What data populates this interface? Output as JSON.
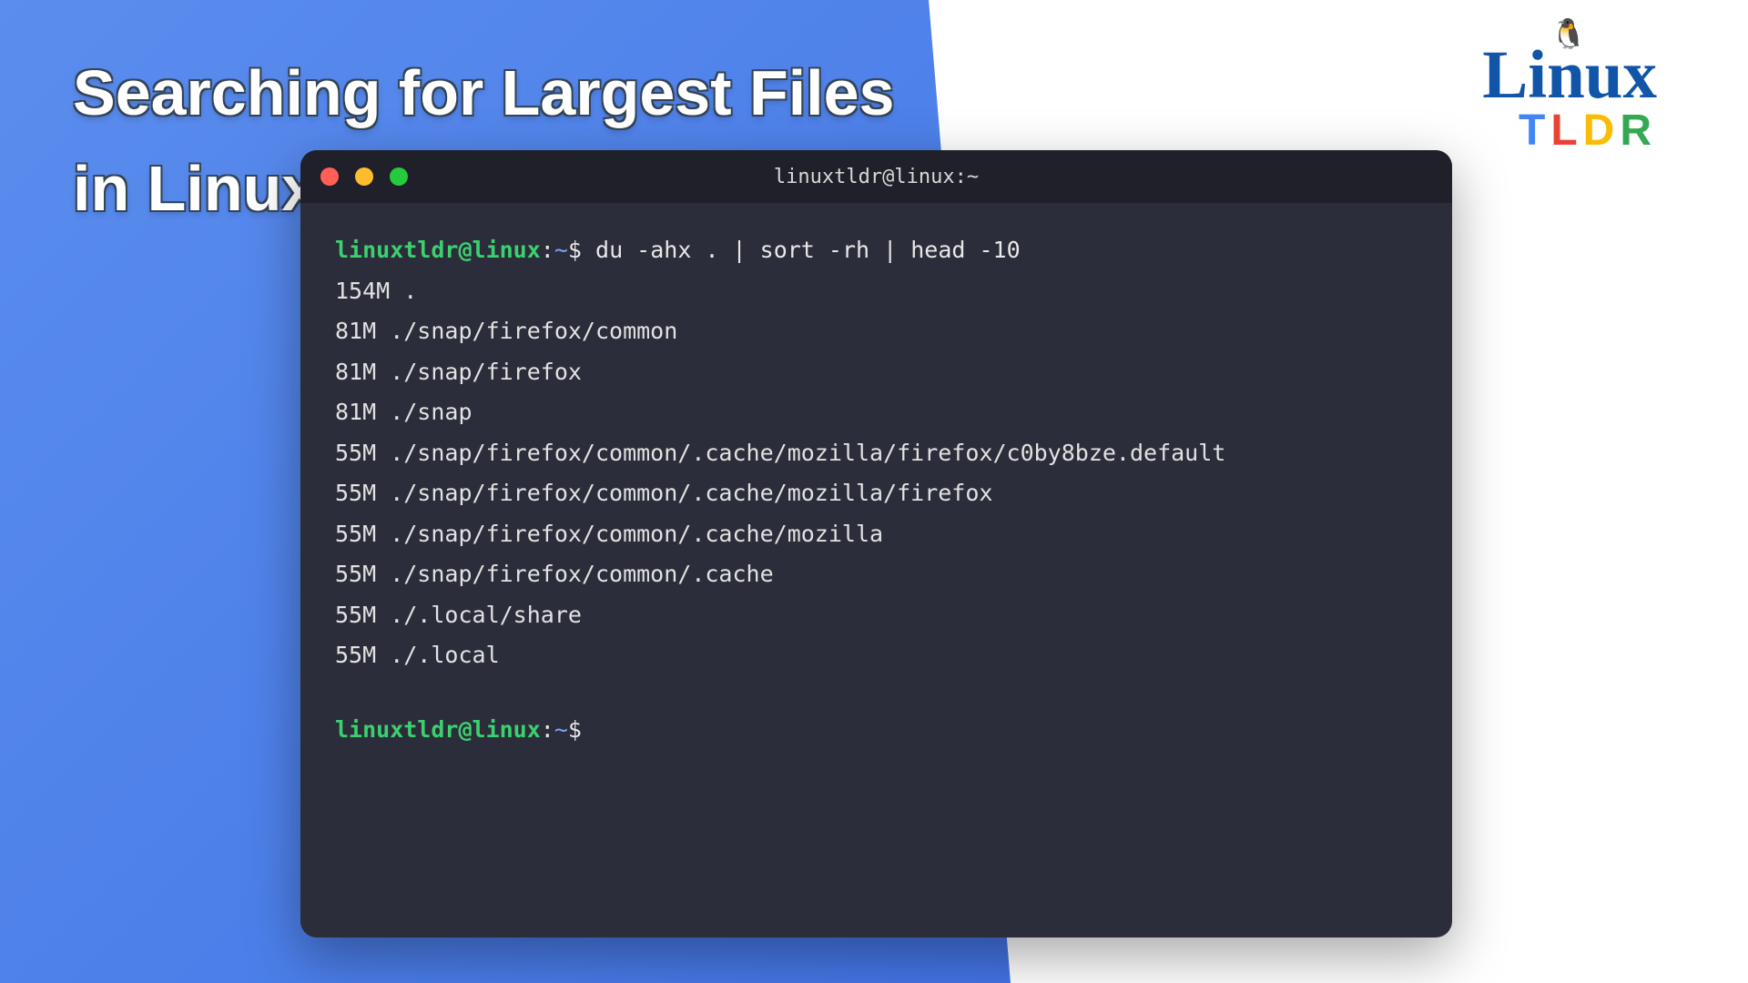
{
  "title_line1": "Searching for Largest Files",
  "title_line2": "in Linux",
  "logo": {
    "brand": "Linux",
    "sub_t": "T",
    "sub_l": "L",
    "sub_d": "D",
    "sub_r": "R"
  },
  "terminal": {
    "window_title": "linuxtldr@linux:~",
    "prompt_user": "linuxtldr@linux",
    "prompt_colon": ":",
    "prompt_path": "~",
    "prompt_dollar": "$",
    "command": "du -ahx . | sort -rh | head -10",
    "output": [
      "154M .",
      "81M ./snap/firefox/common",
      "81M ./snap/firefox",
      "81M ./snap",
      "55M ./snap/firefox/common/.cache/mozilla/firefox/c0by8bze.default",
      "55M ./snap/firefox/common/.cache/mozilla/firefox",
      "55M ./snap/firefox/common/.cache/mozilla",
      "55M ./snap/firefox/common/.cache",
      "55M ./.local/share",
      "55M ./.local"
    ]
  }
}
